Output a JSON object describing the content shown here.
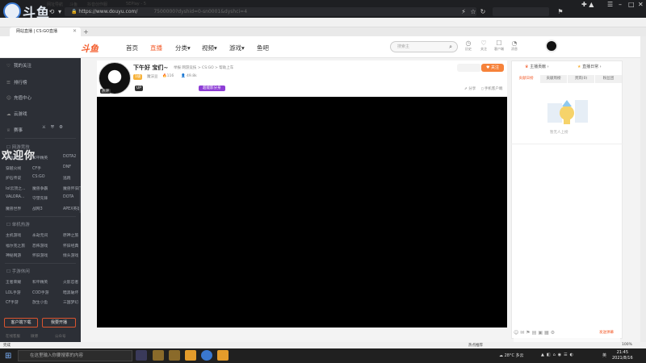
{
  "browser": {
    "watermark": "斗鱼",
    "watermark_id": "7300670",
    "url": "https://www.douyu.com/",
    "url_rest": "7500000?dyshid=0-sn0001&dyshci=4",
    "bookmarks": [
      "网址导航",
      "斗鱼",
      "抖音创作服",
      "5EPlay - 5"
    ],
    "tab_title": "网站直播 | CS:GO直播"
  },
  "header": {
    "logo": "斗鱼",
    "nav": [
      "首页",
      "直播",
      "分类",
      "视频",
      "游戏",
      "鱼吧"
    ],
    "search_placeholder": "搜索主",
    "icons": [
      {
        "glyph": "◷",
        "label": "历史"
      },
      {
        "glyph": "♡",
        "label": "关注"
      },
      {
        "glyph": "☐",
        "label": "客户端"
      },
      {
        "glyph": "◔",
        "label": "消息"
      }
    ]
  },
  "sidebar": {
    "items": [
      {
        "icon": "♡",
        "label": "我的关注"
      },
      {
        "icon": "☰",
        "label": "排行榜"
      },
      {
        "icon": "☺",
        "label": "充值中心"
      },
      {
        "icon": "☁",
        "label": "云游戏"
      },
      {
        "icon": "♕",
        "label": "赛事"
      }
    ],
    "sections": [
      {
        "title": "网游竞技",
        "cells": [
          "英雄联盟",
          "和平精英",
          "DOTA2",
          "穿越火线",
          "CF手",
          "DNF",
          "炉石传说",
          "CS:GO",
          "逃跑",
          "lol云顶之...",
          "魔兽争霸",
          "魔兽怀旧服",
          "VALORA...",
          "守望先锋",
          "DOTA",
          "魔兽世界",
          "战网3",
          "APEX英雄"
        ]
      },
      {
        "title": "单机热游",
        "cells": [
          "主机游戏",
          "永劫无间",
          "原神之旅",
          "福尔克之旅",
          "恐怖游戏",
          "怀旧经典",
          "神秘网游",
          "怀旧游戏",
          "情头游戏"
        ]
      },
      {
        "title": "手游休闲",
        "cells": [
          "王者荣耀",
          "和平精英",
          "火影忍者",
          "LOL手游",
          "COD手游",
          "暗黑破坏",
          "CF手游",
          "放生小鱼",
          "三国梦幻"
        ]
      }
    ],
    "welcome": "欢迎你",
    "buttons": [
      "客户端下载",
      "我要开播"
    ],
    "footer": [
      "在线客服",
      "微博",
      "公众号"
    ]
  },
  "room": {
    "title": "下午好 宝们~",
    "category": "举报  网游竞技 > CS:GO > 帮助上车",
    "level_badge": "1级",
    "streamer_name": "魔法豆",
    "hot": "116",
    "viewers": "49.8k",
    "fan_badge": "UP",
    "event_badge": "超能影分身",
    "actions": [
      "分享",
      "手机客户端"
    ],
    "follow_label": "关注",
    "streamer_tag": "热评"
  },
  "right_panel": {
    "tabs": [
      "主播贡献",
      "直播日常"
    ],
    "subtabs": [
      "贡献日榜",
      "贡献周榜",
      "贵宾(0)",
      "粉丝团"
    ],
    "empty_text": "暂无人上榜",
    "send_label": "发送弹幕"
  },
  "taskbar": {
    "search_placeholder": "在这里输入你要搜索的内容",
    "tray_text": "热点推荐",
    "weather": "28°C 多云",
    "lang": "英",
    "time": "21:45",
    "date": "2021/8/16",
    "status_left": "完成",
    "status_right": "100%"
  },
  "colors": {
    "accent": "#f35b2a",
    "sidebar_bg": "#2c2f36",
    "video_bg": "#000000"
  }
}
